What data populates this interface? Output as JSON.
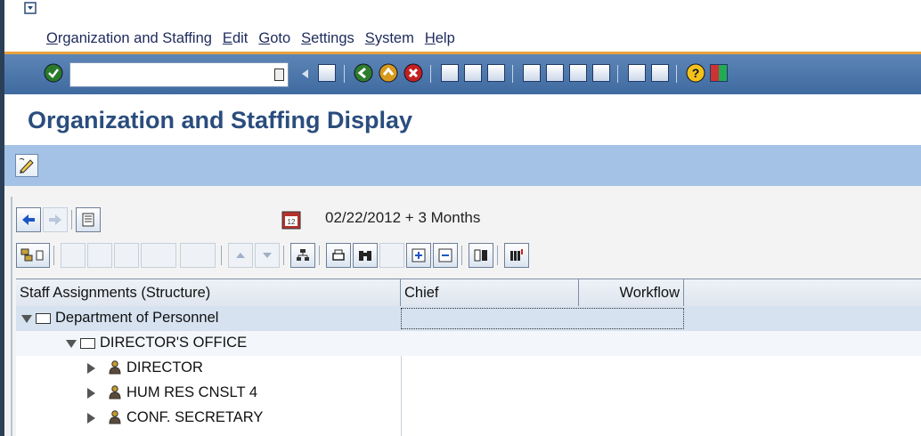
{
  "menu": {
    "items": [
      "Organization and Staffing",
      "Edit",
      "Goto",
      "Settings",
      "System",
      "Help"
    ]
  },
  "toolbar": {
    "command_field": {
      "value": "",
      "placeholder": ""
    }
  },
  "header": {
    "title": "Organization and Staffing Display"
  },
  "period": {
    "text": "02/22/2012  + 3 Months"
  },
  "tree": {
    "columns": [
      "Staff Assignments (Structure)",
      "Chief",
      "Workflow"
    ],
    "rows": [
      {
        "label": "Department of Personnel",
        "type": "org-unit",
        "expanded": true
      },
      {
        "label": "DIRECTOR'S OFFICE",
        "type": "org-unit",
        "expanded": true
      },
      {
        "label": "DIRECTOR",
        "type": "position",
        "expanded": false
      },
      {
        "label": "HUM RES CNSLT 4",
        "type": "position",
        "expanded": false
      },
      {
        "label": "CONF. SECRETARY",
        "type": "position",
        "expanded": false
      }
    ]
  },
  "colors": {
    "toolbar_blue": "#4f78ad",
    "title_blue": "#2a4d7d",
    "app_toolbar": "#a4c2e6",
    "accent_orange": "#e8a13b"
  }
}
